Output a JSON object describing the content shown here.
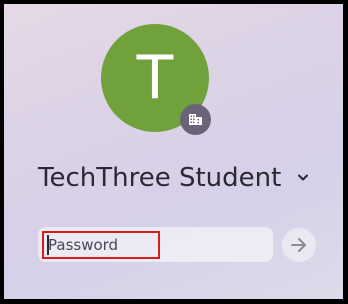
{
  "user": {
    "initial": "T",
    "name": "TechThree Student",
    "avatar_color": "#70a13a",
    "badge_icon": "enterprise-building-icon"
  },
  "password": {
    "placeholder": "Password",
    "value": ""
  },
  "submit": {
    "icon": "arrow-right-icon"
  },
  "colors": {
    "highlight": "#d3201c"
  }
}
